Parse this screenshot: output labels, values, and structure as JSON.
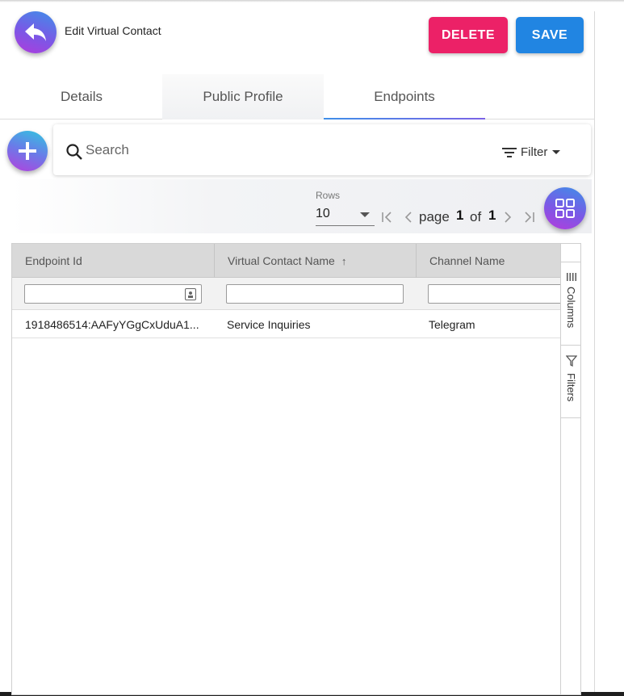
{
  "header": {
    "title": "Edit Virtual Contact",
    "delete_label": "DELETE",
    "save_label": "SAVE"
  },
  "tabs": [
    {
      "label": "Details"
    },
    {
      "label": "Public Profile"
    },
    {
      "label": "Endpoints",
      "active": true
    }
  ],
  "search": {
    "placeholder": "Search",
    "filter_label": "Filter"
  },
  "pagination": {
    "rows_label": "Rows",
    "rows_value": "10",
    "page_word": "page",
    "current_page": "1",
    "of_word": "of",
    "total_pages": "1"
  },
  "grid": {
    "columns": [
      "Endpoint Id",
      "Virtual Contact Name",
      "Channel Name"
    ],
    "sort_indicator": "↑",
    "rows": [
      [
        "1918486514:AAFyYGgCxUduA1...",
        "Service Inquiries",
        "Telegram"
      ]
    ],
    "side_panel": {
      "columns_label": "Columns",
      "filters_label": "Filters"
    }
  },
  "colors": {
    "delete": "#ec2167",
    "save": "#2185e2",
    "accent_gradient_start": "#3f8fe8",
    "accent_gradient_end": "#b03bdc"
  },
  "icons": [
    "back-arrow-icon",
    "plus-icon",
    "search-icon",
    "filter-lines-icon",
    "grid-view-icon",
    "columns-icon",
    "filter-funnel-icon",
    "contact-card-icon"
  ]
}
